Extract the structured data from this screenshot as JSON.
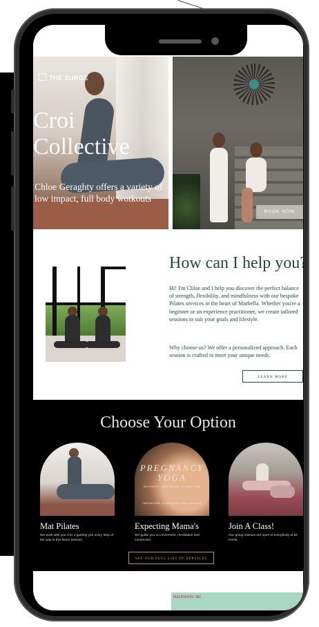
{
  "hero": {
    "brand": "THE SURGE",
    "title_line1": "Croi",
    "title_line2": "Collective",
    "subtitle": "Chloe Geraghty offers a variety of low impact, full body wotkouts",
    "book_button": "BOOK NOW"
  },
  "help": {
    "title": "How can I help you?",
    "paragraph1": "Hi! I'm Chloe and I help you discover the perfect balance of strength, flexibility, and mindfulness with our bespoke Pilates services in the heart of Marbella. Whether you're a beginner or an experience practitioner, we create tailored sessions to suit your goals and lifestyle.",
    "paragraph2": "Why choose us? We offer a personalized approach. Each session is crafted to meet your unique needs.",
    "learn_button": "LEARN MORE"
  },
  "options": {
    "title": "Choose Your Option",
    "cards": [
      {
        "title": "Mat Pilates",
        "desc": "We work with you 1-to-1 guiding you every step of the way in this flexor session."
      },
      {
        "title": "Expecting Mama's",
        "desc": "We guide you on movement, meditation and connection.",
        "image_title": "PREGNANCY YOGA",
        "image_small1": "MOVEMENT • MEDITATION • CONNECTION",
        "image_small2": "TUESDAYS 10AM - 11.30 PM LATINO YOGA CLASS DRIVE"
      },
      {
        "title": "Join A Class!",
        "desc": "Our group classes are open to everybody at all levels."
      }
    ],
    "services_button": "SEE OUR FULL LIST OF SERVICES"
  },
  "map": {
    "label": "Nacimiento del"
  },
  "colors": {
    "accent_green": "#1e4a3a",
    "gold": "#b29a55",
    "background_dark": "#000000"
  }
}
